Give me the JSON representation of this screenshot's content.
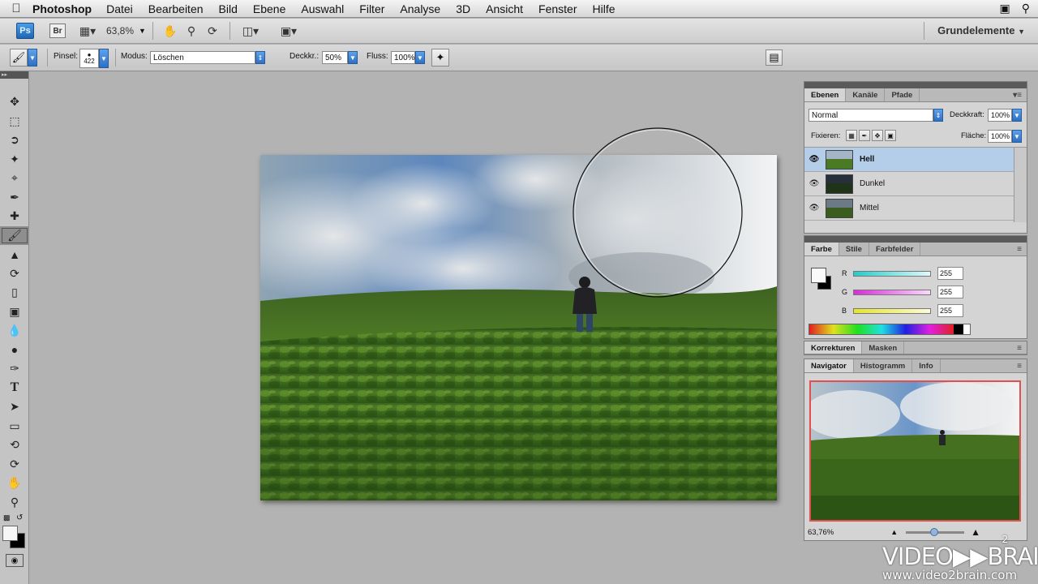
{
  "menubar": {
    "app": "Photoshop",
    "items": [
      "Datei",
      "Bearbeiten",
      "Bild",
      "Ebene",
      "Auswahl",
      "Filter",
      "Analyse",
      "3D",
      "Ansicht",
      "Fenster",
      "Hilfe"
    ]
  },
  "appbar": {
    "ps_badge": "Ps",
    "br_badge": "Br",
    "zoom": "63,8%",
    "workspace": "Grundelemente"
  },
  "options": {
    "brush_label": "Pinsel:",
    "brush_size": "422",
    "mode_label": "Modus:",
    "mode_value": "Löschen",
    "opacity_label": "Deckkr.:",
    "opacity_value": "50%",
    "flow_label": "Fluss:",
    "flow_value": "100%"
  },
  "layers_panel": {
    "tabs": [
      "Ebenen",
      "Kanäle",
      "Pfade"
    ],
    "blend_mode": "Normal",
    "opacity_label": "Deckkraft:",
    "opacity_value": "100%",
    "lock_label": "Fixieren:",
    "fill_label": "Fläche:",
    "fill_value": "100%",
    "layers": [
      {
        "name": "Hell",
        "selected": true
      },
      {
        "name": "Dunkel",
        "selected": false
      },
      {
        "name": "Mittel",
        "selected": false
      }
    ]
  },
  "color_panel": {
    "tabs": [
      "Farbe",
      "Stile",
      "Farbfelder"
    ],
    "channels": [
      {
        "label": "R",
        "value": "255",
        "color": "#22cccc"
      },
      {
        "label": "G",
        "value": "255",
        "color": "#d92ad9"
      },
      {
        "label": "B",
        "value": "255",
        "color": "#e5e52a"
      }
    ]
  },
  "adjust_panel": {
    "tabs": [
      "Korrekturen",
      "Masken"
    ]
  },
  "navigator_panel": {
    "tabs": [
      "Navigator",
      "Histogramm",
      "Info"
    ],
    "zoom": "63,76%",
    "view_box_color": "#e05050"
  },
  "watermark": {
    "brand": "VIDEO▶▶BRAIN",
    "superscript": "2",
    "url": "www.video2brain.com"
  }
}
